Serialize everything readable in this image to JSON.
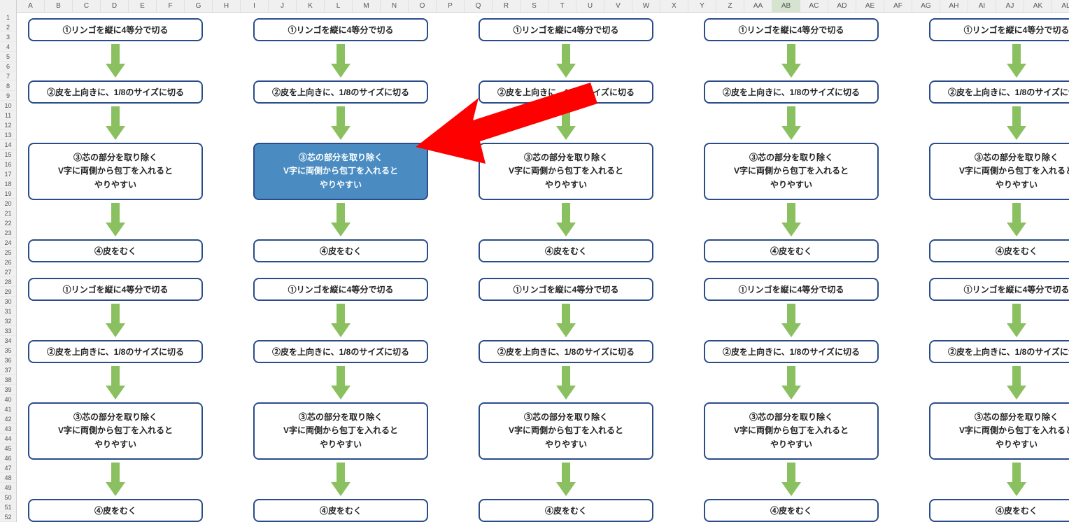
{
  "columns": [
    "A",
    "B",
    "C",
    "D",
    "E",
    "F",
    "G",
    "H",
    "I",
    "J",
    "K",
    "L",
    "M",
    "N",
    "O",
    "P",
    "Q",
    "R",
    "S",
    "T",
    "U",
    "V",
    "W",
    "X",
    "Y",
    "Z",
    "AA",
    "AB",
    "AC",
    "AD",
    "AE",
    "AF",
    "AG",
    "AH",
    "AI",
    "AJ",
    "AK",
    "AL"
  ],
  "selected_col": "AB",
  "rows": [
    1,
    2,
    3,
    4,
    5,
    6,
    7,
    8,
    9,
    10,
    11,
    12,
    13,
    14,
    15,
    16,
    17,
    18,
    19,
    20,
    21,
    22,
    23,
    24,
    25,
    26,
    27,
    28,
    29,
    30,
    31,
    32,
    33,
    34,
    35,
    36,
    37,
    38,
    39,
    40,
    41,
    42,
    43,
    44,
    45,
    46,
    47,
    48,
    49,
    50,
    51,
    52
  ],
  "flow_steps": {
    "s1": "①リンゴを縦に4等分で切る",
    "s2": "②皮を上向きに、1/8のサイズに切る",
    "s3": "③芯の部分を取り除く\nV字に両側から包丁を入れると\nやりやすい",
    "s4": "④皮をむく"
  },
  "highlighted_pos": {
    "row": 0,
    "col": 1
  },
  "grid_rows": 2,
  "grid_cols": 5,
  "colors": {
    "box_border": "#2a4d8a",
    "highlight_fill": "#4a8cc2",
    "arrow_green": "#8bc060",
    "pointer_red": "#ff0000"
  }
}
